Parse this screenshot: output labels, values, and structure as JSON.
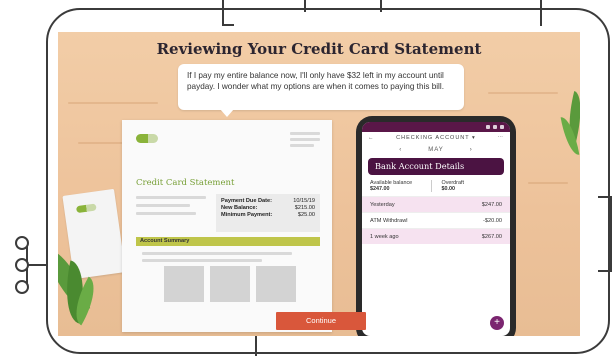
{
  "slide": {
    "title": "Reviewing Your Credit Card Statement",
    "bubble_text": "If I pay my entire balance now, I'll only have $32 left in my account until payday. I wonder what my options are when it comes to paying this bill.",
    "continue_label": "Continue"
  },
  "statement": {
    "title": "Credit Card Statement",
    "due": [
      {
        "label": "Payment Due Date:",
        "value": "10/15/19"
      },
      {
        "label": "New Balance:",
        "value": "$215.00"
      },
      {
        "label": "Minimum Payment:",
        "value": "$25.00"
      }
    ],
    "summary_label": "Account Summary"
  },
  "phone": {
    "account_label": "CHECKING ACCOUNT ▾",
    "month": "MAY",
    "card_title": "Bank Account Details",
    "available_label": "Available balance",
    "available_value": "$247.00",
    "overdraft_label": "Overdraft",
    "overdraft_value": "$0.00",
    "transactions": [
      {
        "label": "Yesterday",
        "amount": "$247.00"
      },
      {
        "label": "ATM Withdrawl",
        "amount": "-$20.00"
      },
      {
        "label": "1 week ago",
        "amount": "$267.00"
      }
    ],
    "fab_label": "+"
  },
  "colors": {
    "accent": "#d9573b",
    "brand": "#4b1342",
    "statement_green": "#78a038",
    "summary_bar": "#bfc54a"
  }
}
